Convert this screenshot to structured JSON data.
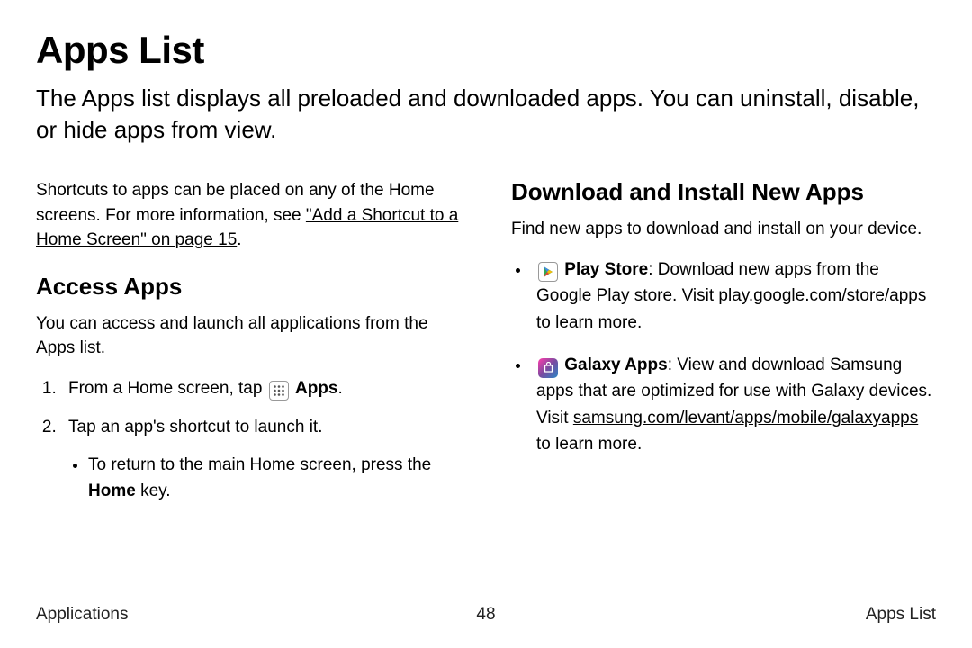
{
  "title": "Apps List",
  "intro": "The Apps list displays all preloaded and downloaded apps. You can uninstall, disable, or hide apps from view.",
  "left": {
    "shortcuts_pre": "Shortcuts to apps can be placed on any of the Home screens. For more information, see ",
    "shortcuts_link": "\"Add a Shortcut to a Home Screen\" on page 15",
    "shortcuts_post": ".",
    "access_h": "Access Apps",
    "access_p": "You can access and launch all applications from the Apps list.",
    "step1_pre": "From a Home screen, tap ",
    "step1_appword": "Apps",
    "step1_post": ".",
    "step2": "Tap an app's shortcut to launch it.",
    "step2_sub_pre": "To return to the main Home screen, press the ",
    "step2_sub_bold": "Home",
    "step2_sub_post": " key."
  },
  "right": {
    "download_h": "Download and Install New Apps",
    "download_p": "Find new apps to download and install on your device.",
    "b1_name": "Play Store",
    "b1_text1": ": Download new apps from the Google Play store. Visit ",
    "b1_link": "play.google.com/store/apps",
    "b1_text2": " to learn more.",
    "b2_name": "Galaxy Apps",
    "b2_text1": ": View and download Samsung apps that are optimized for use with Galaxy devices. Visit ",
    "b2_link": "samsung.com/levant/apps/mobile/galaxyapps",
    "b2_text2": " to learn more."
  },
  "footer": {
    "left": "Applications",
    "center": "48",
    "right": "Apps List"
  }
}
